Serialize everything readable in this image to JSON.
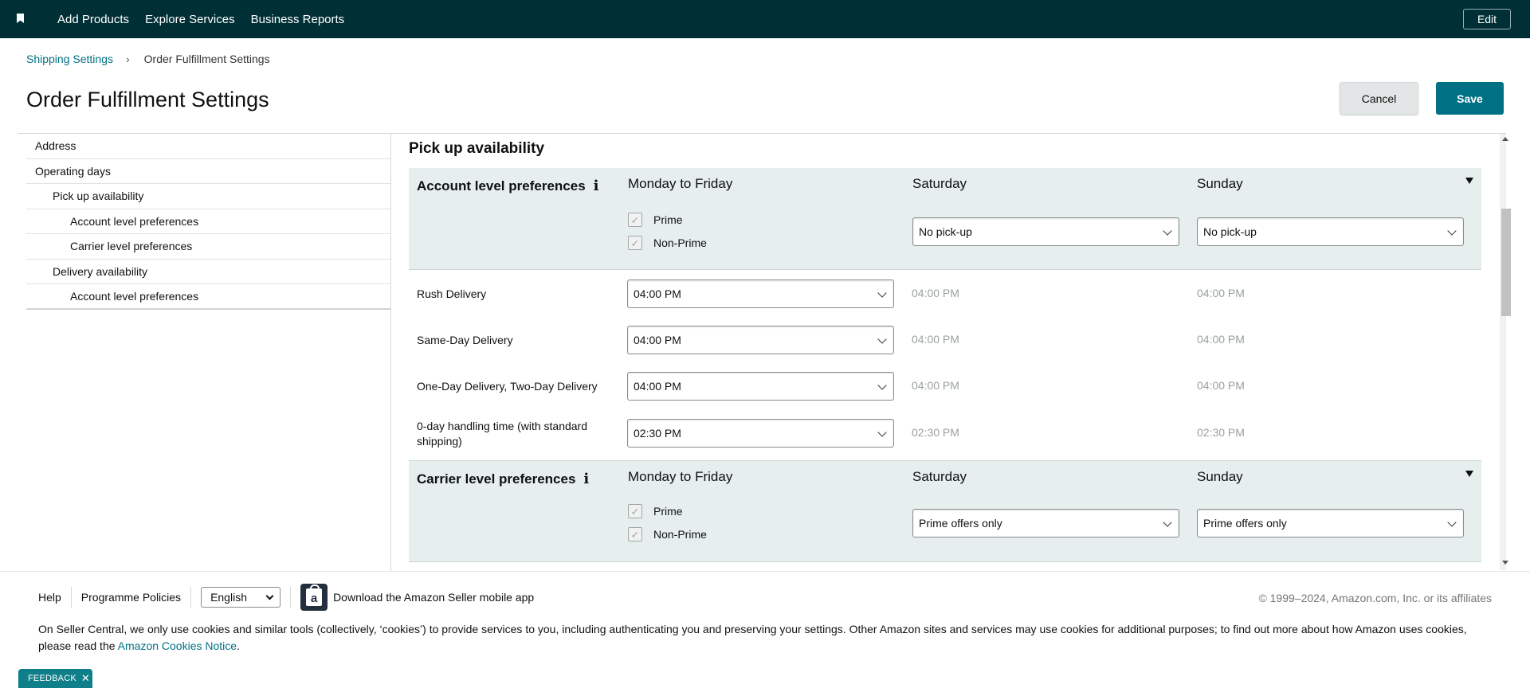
{
  "nav": {
    "links": [
      "Add Products",
      "Explore Services",
      "Business Reports"
    ],
    "edit_label": "Edit"
  },
  "breadcrumb": {
    "parent": "Shipping Settings",
    "separator": "›",
    "current": "Order Fulfillment Settings"
  },
  "page": {
    "title": "Order Fulfillment Settings",
    "cancel_label": "Cancel",
    "save_label": "Save"
  },
  "sidebar": {
    "items": [
      {
        "label": "Address"
      },
      {
        "label": "Operating days"
      },
      {
        "label": "Pick up availability"
      },
      {
        "label": "Account level preferences"
      },
      {
        "label": "Carrier level preferences"
      },
      {
        "label": "Delivery availability"
      },
      {
        "label": "Account level preferences"
      }
    ]
  },
  "main": {
    "section_title": "Pick up availability",
    "days": {
      "weekday": "Monday to Friday",
      "saturday": "Saturday",
      "sunday": "Sunday"
    },
    "account_prefs": {
      "title": "Account level preferences",
      "info_icon": "i",
      "checkbox_prime": "Prime",
      "checkbox_nonprime": "Non-Prime",
      "saturday_value": "No pick-up",
      "sunday_value": "No pick-up"
    },
    "rows": [
      {
        "label": "Rush Delivery",
        "weekday": "04:00 PM",
        "saturday": "04:00 PM",
        "sunday": "04:00 PM"
      },
      {
        "label": "Same-Day Delivery",
        "weekday": "04:00 PM",
        "saturday": "04:00 PM",
        "sunday": "04:00 PM"
      },
      {
        "label": "One-Day Delivery, Two-Day Delivery",
        "weekday": "04:00 PM",
        "saturday": "04:00 PM",
        "sunday": "04:00 PM"
      },
      {
        "label": "0-day handling time (with standard shipping)",
        "weekday": "02:30 PM",
        "saturday": "02:30 PM",
        "sunday": "02:30 PM"
      }
    ],
    "carrier_prefs": {
      "title": "Carrier level preferences",
      "info_icon": "i",
      "checkbox_prime": "Prime",
      "checkbox_nonprime": "Non-Prime",
      "saturday_value": "Prime offers only",
      "sunday_value": "Prime offers only"
    },
    "check_glyph": "✓"
  },
  "footer": {
    "help": "Help",
    "policies": "Programme Policies",
    "language": "English",
    "app_icon_letter": "a",
    "app_text": "Download the Amazon Seller mobile app",
    "copyright": "© 1999–2024, Amazon.com, Inc. or its affiliates",
    "cookie_text": "On Seller Central, we only use cookies and similar tools (collectively, ‘cookies’) to provide services to you, including authenticating you and preserving your settings. Other Amazon sites and services may use cookies for additional purposes; to find out more about how Amazon uses cookies, please read the",
    "cookie_link": "Amazon Cookies Notice",
    "cookie_end": "."
  },
  "feedback": {
    "label": "FEEDBACK",
    "close": "✕"
  },
  "colors": {
    "nav_bg": "#002f36",
    "accent": "#007185",
    "band_bg": "#e6eeee"
  }
}
